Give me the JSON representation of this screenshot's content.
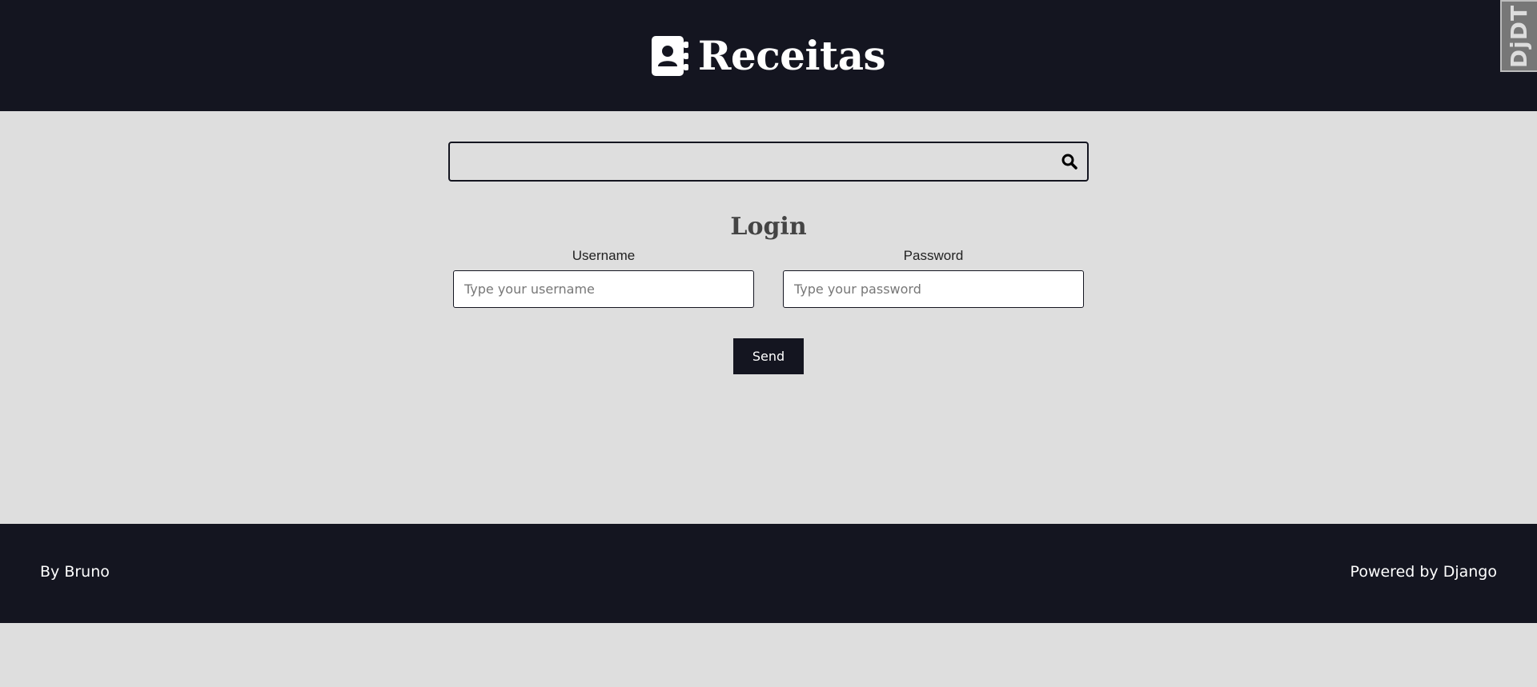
{
  "header": {
    "brand_title": "Receitas",
    "brand_icon": "address-book-icon",
    "toolbar_badge": "DjDT"
  },
  "search": {
    "value": "",
    "placeholder": "",
    "button_icon": "search-icon"
  },
  "login": {
    "title": "Login",
    "username_label": "Username",
    "username_placeholder": "Type your username",
    "password_label": "Password",
    "password_placeholder": "Type your password",
    "send_label": "Send"
  },
  "footer": {
    "left_text": "By Bruno",
    "right_text": "Powered by Django"
  },
  "colors": {
    "dark": "#141520",
    "background": "#dedede",
    "text_on_dark": "#ffffff"
  }
}
